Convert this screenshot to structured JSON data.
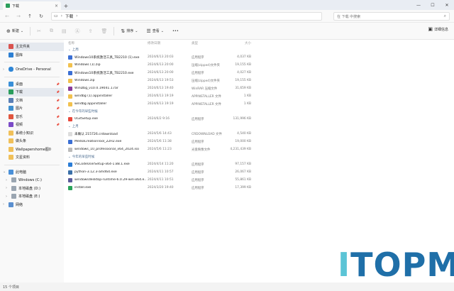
{
  "tab": {
    "title": "下载",
    "close": "×",
    "new": "+"
  },
  "window_controls": {
    "minimize": "—",
    "maximize": "☐",
    "close": "✕"
  },
  "address": {
    "path": "下载",
    "search_placeholder": "在 下载 中搜索"
  },
  "commands": {
    "new": "新建",
    "sort": "排序",
    "view": "查看",
    "more": "•••",
    "details": "详细信息"
  },
  "columns": {
    "name": "名称",
    "date": "修改日期",
    "type": "类型",
    "size": "大小"
  },
  "sidebar": {
    "top": [
      {
        "label": "主文件夹",
        "color": "#d9534f",
        "active": true
      },
      {
        "label": "图库",
        "color": "#2d7fd3"
      }
    ],
    "onedrive": {
      "label": "OneDrive - Personal",
      "color": "#2f86d6"
    },
    "quick": [
      {
        "label": "桌面",
        "color": "#3a8fd8"
      },
      {
        "label": "下载",
        "color": "#2a9d5c",
        "active": true
      },
      {
        "label": "文档",
        "color": "#5a7fb5"
      },
      {
        "label": "图片",
        "color": "#3f8fcf"
      },
      {
        "label": "音乐",
        "color": "#e0563f"
      },
      {
        "label": "视频",
        "color": "#7b4bc7"
      },
      {
        "label": "系统小知识",
        "color": "#f0c05a"
      },
      {
        "label": "做头条",
        "color": "#f0c05a"
      },
      {
        "label": "Wallpapershome图0",
        "color": "#f0c05a"
      },
      {
        "label": "文星资料",
        "color": "#f0c05a"
      }
    ],
    "pc": {
      "label": "此电脑",
      "color": "#4a90d9"
    },
    "drives": [
      {
        "label": "Windows (C:)"
      },
      {
        "label": "本地磁盘 (D:)"
      },
      {
        "label": "本地磁盘 (E:)"
      }
    ],
    "network": {
      "label": "网络"
    }
  },
  "groups": [
    {
      "label": "上周",
      "rows": [
        {
          "name": "Windows10系统激活工具_TB2210 (1).exe",
          "date": "2024/6/13 20:03",
          "type": "应用程序",
          "size": "4,037 KB",
          "color": "#3b6fd4"
        },
        {
          "name": "Windows (1).zip",
          "date": "2024/6/13 20:00",
          "type": "压缩(zipped)文件夹",
          "size": "19,155 KB",
          "color": "#f2c14e"
        },
        {
          "name": "Windows10系统激活工具_TB2210.exe",
          "date": "2024/6/13 20:00",
          "type": "应用程序",
          "size": "4,027 KB",
          "color": "#3b6fd4"
        },
        {
          "name": "Windows.zip",
          "date": "2024/6/13 19:53",
          "type": "压缩(zipped)文件夹",
          "size": "19,155 KB",
          "color": "#f2c14e"
        },
        {
          "name": "WinDbg_v10.0.19041.1.rar",
          "date": "2024/6/13 19:40",
          "type": "WinRAR 压缩文件",
          "size": "31,659 KB",
          "color": "#8a3b9a"
        },
        {
          "name": "windbg (1).appinstaller",
          "date": "2024/6/13 19:19",
          "type": "APPINSTALLER 文件",
          "size": "1 KB",
          "color": "#f2c14e"
        },
        {
          "name": "windbg.appinstaller",
          "date": "2024/6/13 19:19",
          "type": "APPINSTALLER 文件",
          "size": "1 KB",
          "color": "#f2c14e"
        }
      ]
    },
    {
      "label": "在今年的早些时候",
      "rows": [
        {
          "name": "UGitSetup.exe",
          "date": "2024/6/2 9:16",
          "type": "应用程序",
          "size": "131,996 KB",
          "color": "#e8483b"
        }
      ]
    },
    {
      "label": "上月",
      "rows": [
        {
          "name": "未确认 215726.crdownload",
          "date": "2024/5/6 14:43",
          "type": "CRDOWNLOAD 文件",
          "size": "4,540 KB",
          "color": "#dddddd"
        },
        {
          "name": "MediaCreationTool_22H2.exe",
          "date": "2024/5/6 11:38",
          "type": "应用程序",
          "size": "19,000 KB",
          "color": "#3b6fd4"
        },
        {
          "name": "windows_10_professional_x64_2024.iso",
          "date": "2024/5/6 11:23",
          "type": "光盘映像文件",
          "size": "4,231,439 KB",
          "color": "#bbbbbb"
        }
      ]
    },
    {
      "label": "今年的早些时候",
      "rows": [
        {
          "name": "VSCodeUserSetup-x64-1.88.1.exe",
          "date": "2024/4/14 11:20",
          "type": "应用程序",
          "size": "97,157 KB",
          "color": "#2b7dd6"
        },
        {
          "name": "python-3.12.3-amd64.exe",
          "date": "2024/4/11 10:57",
          "type": "应用程序",
          "size": "26,067 KB",
          "color": "#3a6fa8"
        },
        {
          "name": "windowsdesktop-runtime-6.0.29-win-x64.e...",
          "date": "2024/4/11 10:51",
          "type": "应用程序",
          "size": "55,861 KB",
          "color": "#5a5a9a"
        },
        {
          "name": "install.exe",
          "date": "2024/3/20 19:40",
          "type": "应用程序",
          "size": "17,399 KB",
          "color": "#2aa35a"
        }
      ]
    }
  ],
  "status": {
    "count": "15 个项目"
  },
  "watermark": {
    "first": "I",
    "rest": "TOPM"
  }
}
